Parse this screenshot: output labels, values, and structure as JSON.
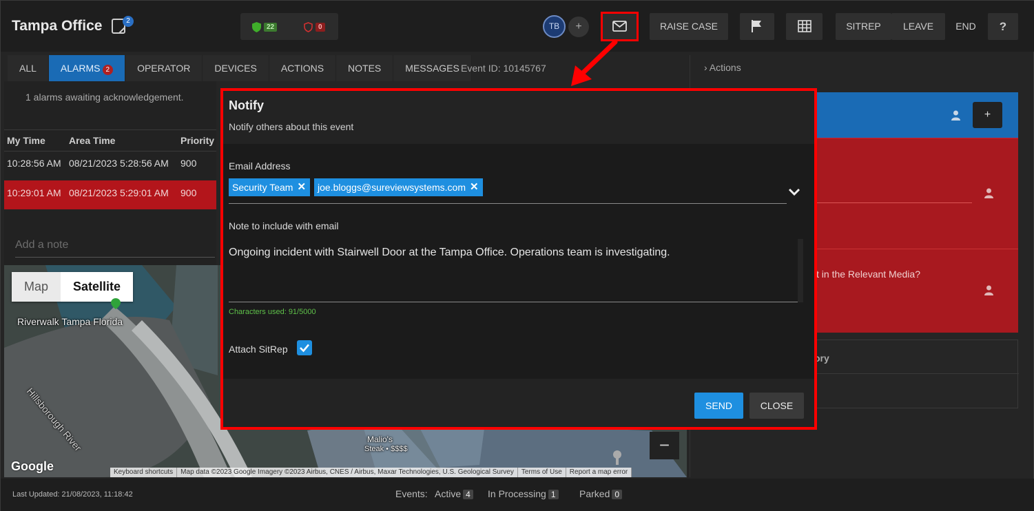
{
  "header": {
    "site_title": "Tampa Office",
    "note_count": "2",
    "shield_ok_count": "22",
    "shield_alert_count": "0",
    "avatar_initials": "TB",
    "add_label": "+",
    "raise_case": "RAISE CASE",
    "sitrep": "SITREP",
    "leave": "LEAVE",
    "end": "END",
    "help": "?"
  },
  "tabs": [
    {
      "label": "ALL"
    },
    {
      "label": "ALARMS",
      "badge": "2"
    },
    {
      "label": "OPERATOR"
    },
    {
      "label": "DEVICES"
    },
    {
      "label": "ACTIONS"
    },
    {
      "label": "NOTES"
    },
    {
      "label": "MESSAGES"
    }
  ],
  "event_id": "Event ID: 10145767",
  "alarms": {
    "awaiting_text": "1 alarms awaiting acknowledgement.",
    "columns": [
      "My Time",
      "Area Time",
      "Priority"
    ],
    "rows": [
      [
        "10:28:56 AM",
        "08/21/2023 5:28:56 AM",
        "900"
      ],
      [
        "10:29:01 AM",
        "08/21/2023 5:29:01 AM",
        "900"
      ]
    ],
    "add_note_placeholder": "Add a note"
  },
  "map": {
    "type_map": "Map",
    "type_satellite": "Satellite",
    "label_riverwalk": "Riverwalk Tampa Florida",
    "label_river": "Hillsborough River",
    "label_malios": "Malio's",
    "label_steak": "Steak • $$$$",
    "google": "Google",
    "footer": [
      "Keyboard shortcuts",
      "Map data ©2023 Google Imagery ©2023 Airbus, CNES / Airbus, Maxar Technologies, U.S. Geological Survey",
      "Terms of Use",
      "Report a map error"
    ]
  },
  "right": {
    "actions_label": "Actions",
    "media_text": "t in the Relevant Media?",
    "history_text": "ory",
    "plus": "+"
  },
  "notify": {
    "title": "Notify",
    "subtitle": "Notify others about this event",
    "email_label": "Email Address",
    "recipients": [
      "Security Team",
      "joe.bloggs@sureviewsystems.com"
    ],
    "note_label": "Note to include with email",
    "note_text": "Ongoing incident with Stairwell Door at the Tampa Office. Operations team is investigating.",
    "chars_used": "Characters used: 91/5000",
    "attach_label": "Attach SitRep",
    "attach_checked": true,
    "send": "SEND",
    "close": "CLOSE"
  },
  "status": {
    "last_updated": "Last Updated: 21/08/2023, 11:18:42",
    "events_label": "Events:",
    "active_label": "Active",
    "active_count": "4",
    "processing_label": "In Processing",
    "processing_count": "1",
    "parked_label": "Parked",
    "parked_count": "0"
  },
  "colors": {
    "accent_blue": "#1e8fe0",
    "alarm_red": "#b3151b",
    "highlight_red": "#ff0000"
  }
}
